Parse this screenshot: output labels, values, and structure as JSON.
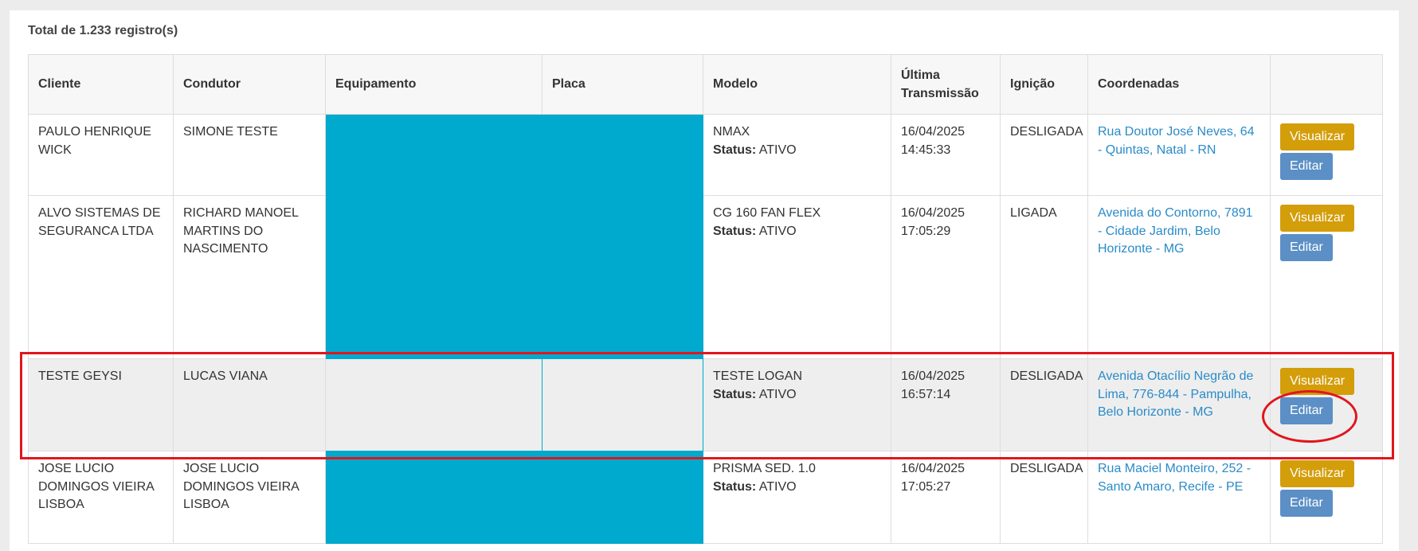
{
  "summary": "Total de 1.233 registro(s)",
  "columns": [
    "Cliente",
    "Condutor",
    "Equipamento",
    "Placa",
    "Modelo",
    "Última Transmissão",
    "Ignição",
    "Coordenadas",
    ""
  ],
  "status_label": "Status:",
  "buttons": {
    "view": "Visualizar",
    "edit": "Editar"
  },
  "colors": {
    "view_button": "#d49d0a",
    "edit_button": "#5b8fc6",
    "link": "#2a8bc9",
    "redaction": "#00a9ce",
    "annotation": "#e0161c"
  },
  "rows": [
    {
      "cliente": "PAULO HENRIQUE WICK",
      "condutor": "SIMONE TESTE",
      "modelo": "NMAX",
      "status": "ATIVO",
      "data": "16/04/2025",
      "hora": "14:45:33",
      "ignicao": "DESLIGADA",
      "endereco": "Rua Doutor José Neves, 64 - Quintas, Natal - RN"
    },
    {
      "cliente": "ALVO SISTEMAS DE SEGURANCA LTDA",
      "condutor": "RICHARD MANOEL MARTINS DO NASCIMENTO",
      "modelo": "CG 160 FAN FLEX",
      "status": "ATIVO",
      "data": "16/04/2025",
      "hora": "17:05:29",
      "ignicao": "LIGADA",
      "endereco": "Avenida do Contorno, 7891 - Cidade Jardim, Belo Horizonte - MG"
    },
    {
      "cliente": "TESTE GEYSI",
      "condutor": "LUCAS VIANA",
      "modelo": "TESTE LOGAN",
      "status": "ATIVO",
      "data": "16/04/2025",
      "hora": "16:57:14",
      "ignicao": "DESLIGADA",
      "endereco": "Avenida Otacílio Negrão de Lima, 776-844 - Pampulha, Belo Horizonte - MG"
    },
    {
      "cliente": "JOSE LUCIO DOMINGOS VIEIRA LISBOA",
      "condutor": "JOSE LUCIO DOMINGOS VIEIRA LISBOA",
      "modelo": "PRISMA SED. 1.0",
      "status": "ATIVO",
      "data": "16/04/2025",
      "hora": "17:05:27",
      "ignicao": "DESLIGADA",
      "endereco": "Rua Maciel Monteiro, 252 - Santo Amaro, Recife - PE"
    }
  ]
}
